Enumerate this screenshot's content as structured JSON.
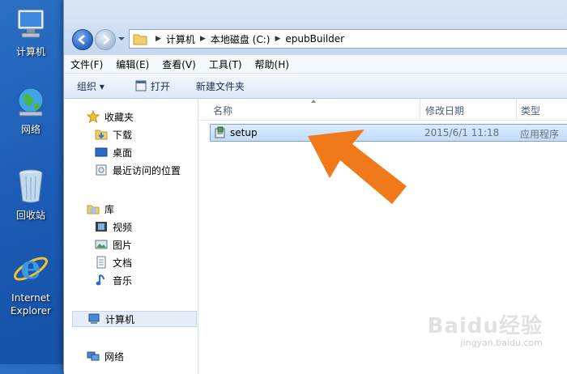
{
  "desktop": {
    "icons": [
      {
        "label": "计算机",
        "icon": "computer-icon"
      },
      {
        "label": "网络",
        "icon": "network-globe-icon"
      },
      {
        "label": "回收站",
        "icon": "recycle-bin-icon"
      },
      {
        "label": "Internet Explorer",
        "label_line1": "Internet",
        "label_line2": "Explorer",
        "icon": "internet-explorer-icon"
      }
    ]
  },
  "window": {
    "address": {
      "crumbs": [
        "计算机",
        "本地磁盘 (C:)",
        "epubBuilder"
      ]
    },
    "menu": [
      "文件(F)",
      "编辑(E)",
      "查看(V)",
      "工具(T)",
      "帮助(H)"
    ],
    "toolbar": {
      "organize": "组织 ▾",
      "open": "打开",
      "new_folder": "新建文件夹"
    },
    "nav": {
      "favorites": "收藏夹",
      "favorites_items": [
        "下载",
        "桌面",
        "最近访问的位置"
      ],
      "libraries": "库",
      "library_items": [
        "视频",
        "图片",
        "文档",
        "音乐"
      ],
      "computer": "计算机",
      "network": "网络"
    },
    "columns": {
      "name": "名称",
      "modified": "修改日期",
      "type": "类型"
    },
    "files": [
      {
        "name": "setup",
        "modified": "2015/6/1 11:18",
        "type": "应用程序",
        "selected": true
      }
    ]
  },
  "watermark": {
    "brand": "Baidu经验",
    "url": "jingyan.baidu.com"
  },
  "colors": {
    "desktop": "#1d5cb6",
    "arrow": "#f07a1a",
    "selection": "#c1dcfb"
  }
}
